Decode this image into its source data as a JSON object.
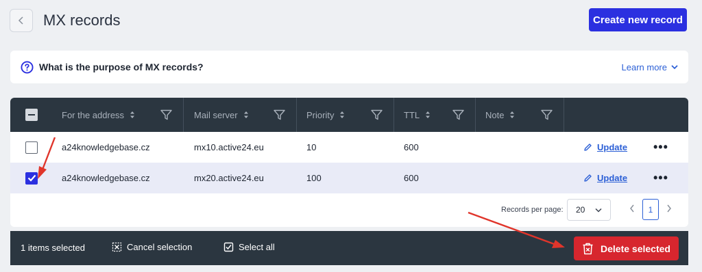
{
  "header": {
    "title": "MX records",
    "create_label": "Create new record"
  },
  "info": {
    "question": "What is the purpose of MX records?",
    "learn_more": "Learn more"
  },
  "table": {
    "columns": [
      "For the address",
      "Mail server",
      "Priority",
      "TTL",
      "Note"
    ],
    "rows": [
      {
        "address": "a24knowledgebase.cz",
        "server": "mx10.active24.eu",
        "priority": "10",
        "ttl": "600",
        "note": "",
        "selected": false,
        "update": "Update"
      },
      {
        "address": "a24knowledgebase.cz",
        "server": "mx20.active24.eu",
        "priority": "100",
        "ttl": "600",
        "note": "",
        "selected": true,
        "update": "Update"
      }
    ]
  },
  "pagination": {
    "rpp_label": "Records per page:",
    "rpp_value": "20",
    "current_page": "1"
  },
  "bulk": {
    "count_text": "1 items selected",
    "cancel_label": "Cancel selection",
    "select_all_label": "Select all",
    "delete_label": "Delete selected"
  },
  "colors": {
    "primary": "#2b30e0",
    "danger": "#d7262e",
    "dark": "#2b3640",
    "annotation_arrow": "#e0352b"
  },
  "icons": [
    "chevron-left-icon",
    "question-circle-icon",
    "chevron-down-icon",
    "sort-icon",
    "filter-icon",
    "pencil-icon",
    "more-dots-icon",
    "cancel-selection-icon",
    "checkbox-icon",
    "trash-icon",
    "chevron-right-icon"
  ]
}
